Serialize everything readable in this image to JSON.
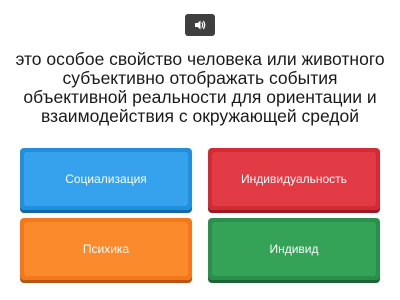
{
  "sound_button": {
    "icon": "speaker-icon"
  },
  "question": {
    "text": "это особое свойство человека или животного субъективно отображать события объективной реальности для ориентации и взаимодействия с окружающей средой"
  },
  "answers": [
    {
      "label": "Социализация",
      "color": "#36a2ee"
    },
    {
      "label": "Индивидуальность",
      "color": "#e23b45"
    },
    {
      "label": "Психика",
      "color": "#fb8a2c"
    },
    {
      "label": "Индивид",
      "color": "#34a257"
    }
  ]
}
